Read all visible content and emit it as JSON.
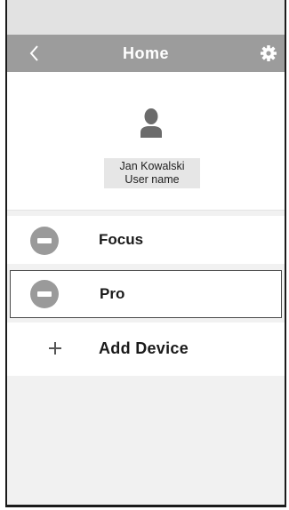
{
  "navbar": {
    "title": "Home",
    "back_icon": "chevron-left-icon",
    "settings_icon": "gear-icon"
  },
  "profile": {
    "avatar_icon": "user-silhouette-icon",
    "name": "Jan Kowalski",
    "subtitle": "User name"
  },
  "devices": [
    {
      "label": "Focus",
      "icon": "device-icon",
      "selected": false
    },
    {
      "label": "Pro",
      "icon": "device-icon",
      "selected": true
    }
  ],
  "add_device": {
    "label": "Add Device",
    "icon": "plus-icon"
  },
  "colors": {
    "navbar_bg": "#9c9c9c",
    "statusbar_bg": "#e2e2e2",
    "list_bg": "#ffffff",
    "empty_bg": "#f1f1f1",
    "device_icon": "#9a9a9a",
    "selection_border": "#4a4a4a"
  }
}
